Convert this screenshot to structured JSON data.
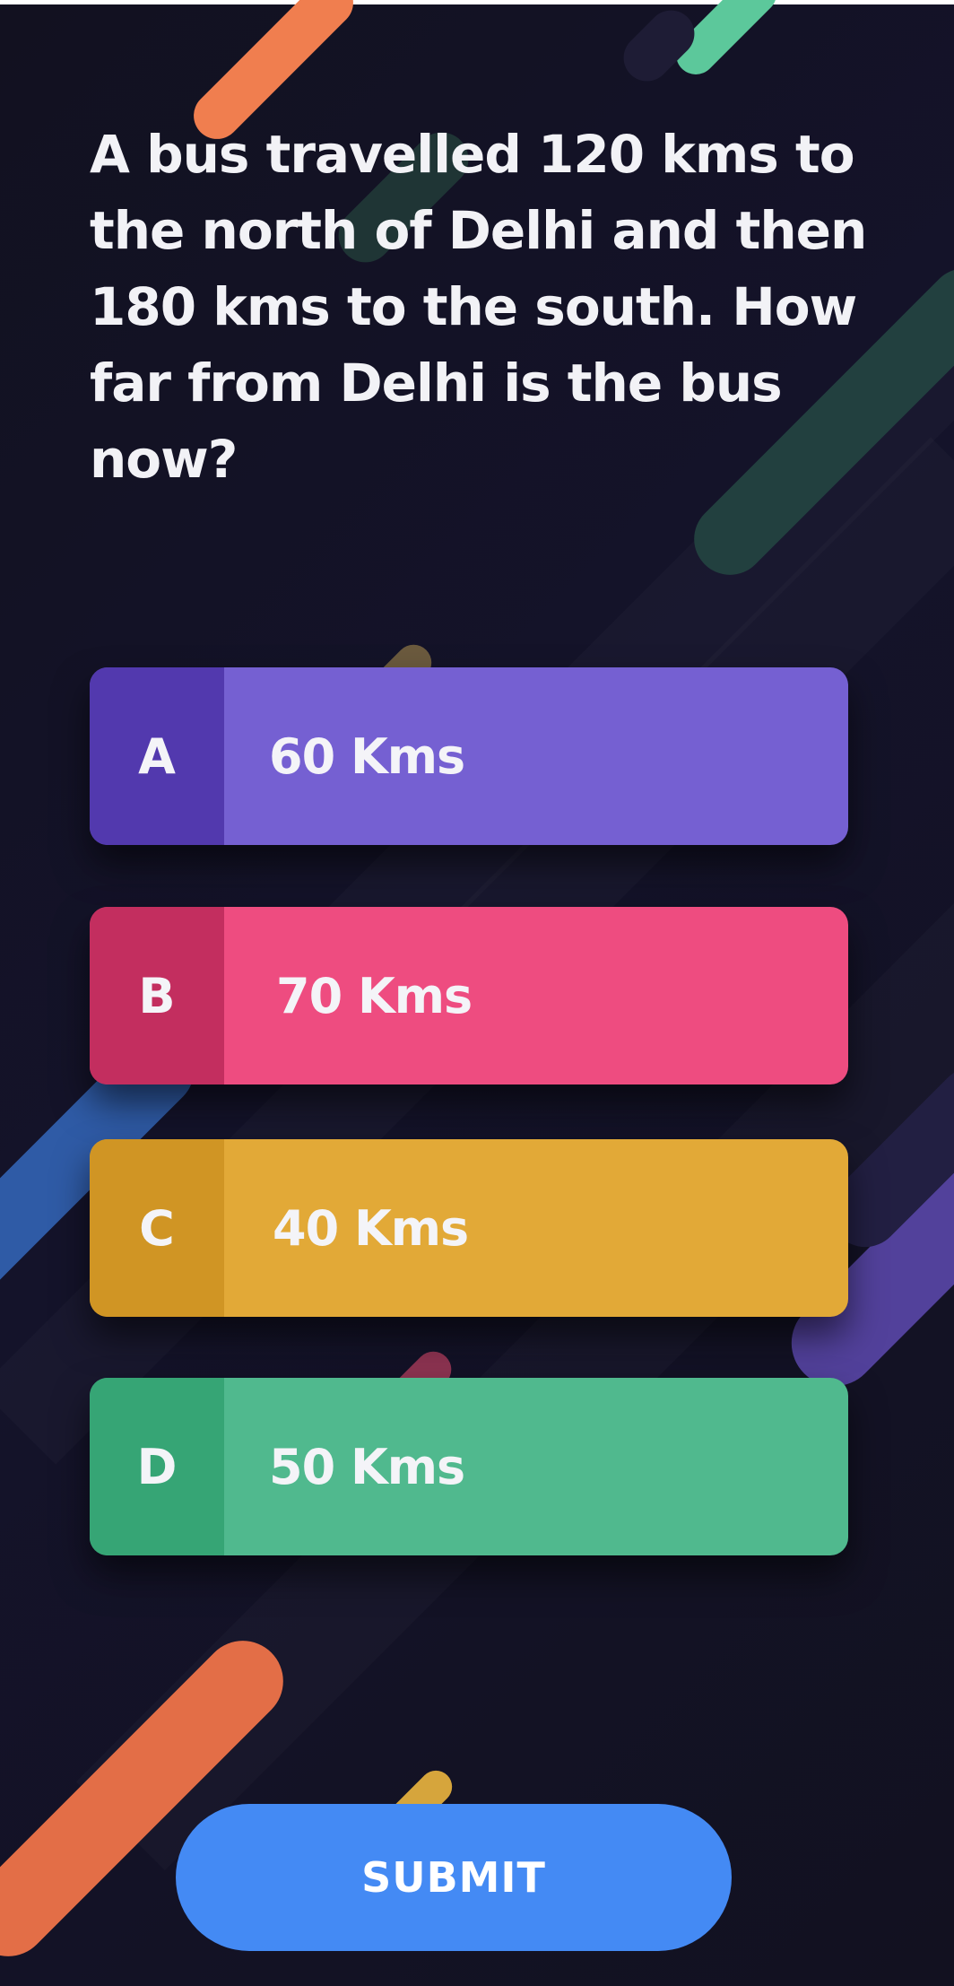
{
  "question": {
    "text": "A bus travelled 120 kms to the north of Delhi and then 180 kms to the south. How far from Delhi is the bus now?"
  },
  "options": [
    {
      "letter": "A",
      "text": "60 Kms",
      "color": "#7560d2",
      "accent": "#5239ae"
    },
    {
      "letter": "B",
      "text": "70 Kms",
      "color": "#ee4c80",
      "accent": "#c32e5f"
    },
    {
      "letter": "C",
      "text": "40 Kms",
      "color": "#e2a937",
      "accent": "#d09524"
    },
    {
      "letter": "D",
      "text": "50 Kms",
      "color": "#50b98e",
      "accent": "#36a575"
    }
  ],
  "submit": {
    "label": "SUBMIT",
    "color": "#448af4"
  },
  "theme": {
    "background": "#13121f"
  }
}
